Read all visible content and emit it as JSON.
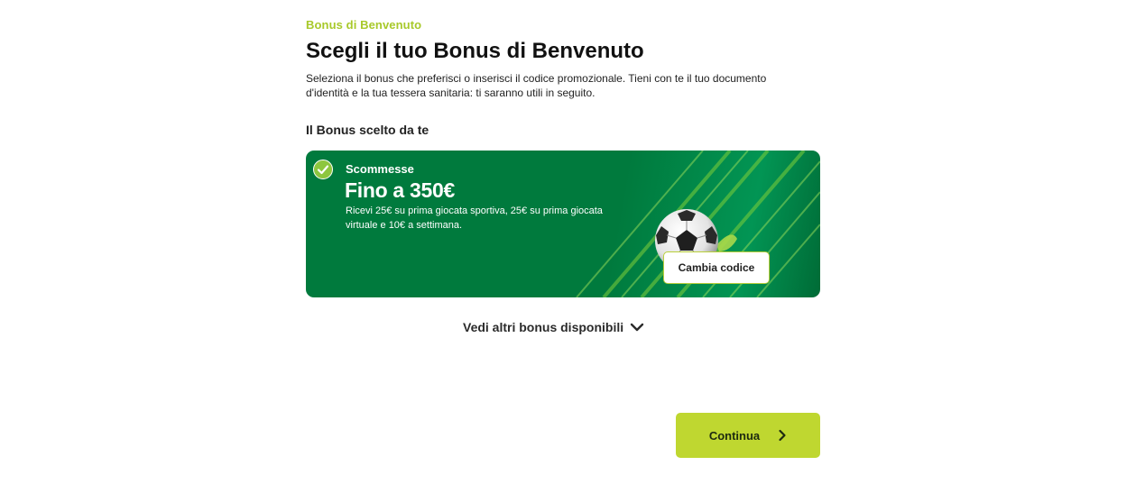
{
  "header": {
    "eyebrow": "Bonus di Benvenuto",
    "title": "Scegli il tuo Bonus di Benvenuto",
    "intro": "Seleziona il bonus che preferisci o inserisci il codice promozionale. Tieni con te il tuo documento d'identità e la tua tessera sanitaria: ti saranno utili in seguito."
  },
  "selected_section": {
    "label": "Il Bonus scelto da te"
  },
  "bonus_card": {
    "category": "Scommesse",
    "amount": "Fino a 350€",
    "description": "Ricevi 25€ su prima giocata sportiva, 25€ su prima giocata virtuale e 10€ a settimana.",
    "change_button": "Cambia codice",
    "selected_icon": "check-circle-icon",
    "image_icon": "soccer-ball-icon"
  },
  "more_bonuses": {
    "label": "Vedi altri bonus disponibili",
    "icon": "chevron-down-icon"
  },
  "footer": {
    "continue_label": "Continua",
    "continue_icon": "chevron-right-icon"
  },
  "colors": {
    "accent_lime": "#bfd730",
    "eyebrow_green": "#a8c92a",
    "card_green": "#007a3d",
    "check_green": "#8dc63f"
  }
}
